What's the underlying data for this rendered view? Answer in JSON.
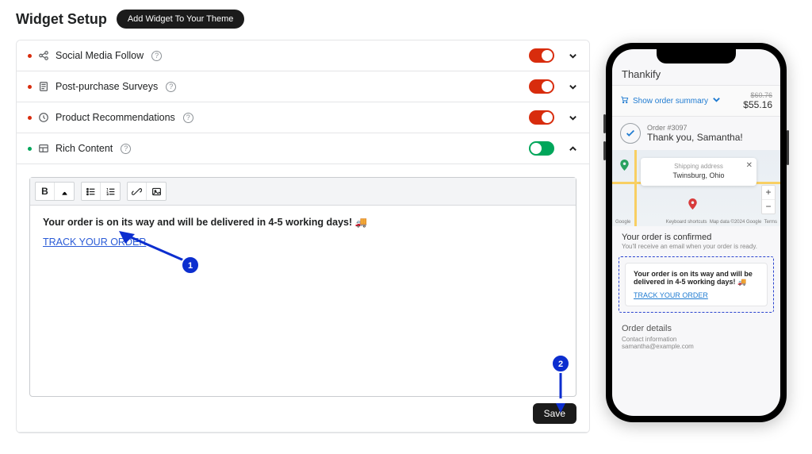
{
  "header": {
    "title": "Widget Setup",
    "add_button": "Add Widget To Your Theme"
  },
  "widgets": [
    {
      "label": "Social Media Follow",
      "enabled": false,
      "expanded": false,
      "icon": "share"
    },
    {
      "label": "Post-purchase Surveys",
      "enabled": false,
      "expanded": false,
      "icon": "form"
    },
    {
      "label": "Product Recommendations",
      "enabled": false,
      "expanded": false,
      "icon": "clock"
    },
    {
      "label": "Rich Content",
      "enabled": true,
      "expanded": true,
      "icon": "layout"
    }
  ],
  "editor": {
    "tools": {
      "bold": "B",
      "color": "A",
      "ul": "ul",
      "ol": "ol",
      "link": "link",
      "image": "image"
    },
    "content": {
      "line1_prefix": "Your order is on its way and will be delivered in 4-5 working days! ",
      "truck": "🚚",
      "link_text": "TRACK YOUR ORDER"
    }
  },
  "callouts": {
    "one": "1",
    "two": "2"
  },
  "save_label": "Save",
  "preview": {
    "brand": "Thankify",
    "summary_label": "Show order summary",
    "old_price": "$60.76",
    "price": "$55.16",
    "order_no": "Order #3097",
    "thank_you": "Thank you, Samantha!",
    "ship_card": {
      "heading": "Shipping address",
      "value": "Twinsburg, Ohio"
    },
    "map_footer": {
      "google": "Google",
      "shortcuts": "Keyboard shortcuts",
      "data": "Map data ©2024 Google",
      "terms": "Terms"
    },
    "confirmed": {
      "heading": "Your order is confirmed",
      "sub": "You'll receive an email when your order is ready."
    },
    "rich_card": {
      "line": "Your order is on its way and will be delivered in 4-5 working days! 🚚",
      "link": "TRACK YOUR ORDER"
    },
    "details": {
      "heading": "Order details",
      "contact_label": "Contact information",
      "contact_value": "samantha@example.com"
    }
  }
}
